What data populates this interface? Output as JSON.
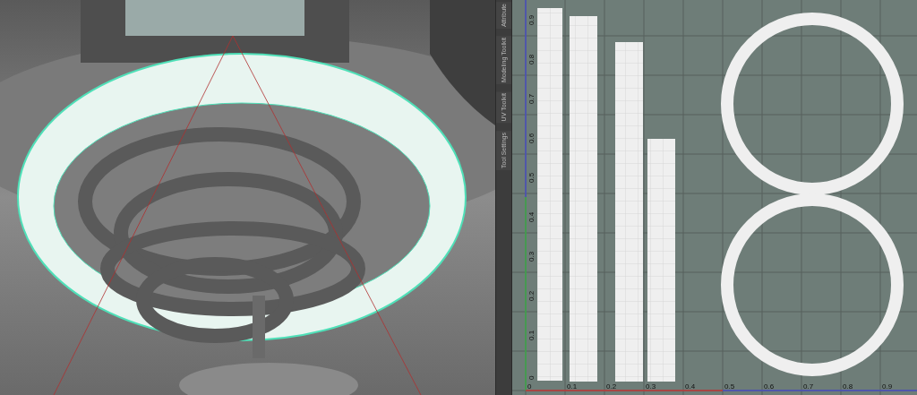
{
  "side_tabs": [
    {
      "label": "Attribute"
    },
    {
      "label": "Modeling Toolkit"
    },
    {
      "label": "UV Toolkit"
    },
    {
      "label": "Tool Settings"
    }
  ],
  "uv_editor": {
    "u_ticks": [
      "0",
      "0.1",
      "0.2",
      "0.3",
      "0.4",
      "0.5",
      "0.6",
      "0.7",
      "0.8",
      "0.9"
    ],
    "v_ticks": [
      "0.9",
      "0.8",
      "0.7",
      "0.6",
      "0.5",
      "0.4",
      "0.3",
      "0.2",
      "0.1",
      "0"
    ]
  }
}
